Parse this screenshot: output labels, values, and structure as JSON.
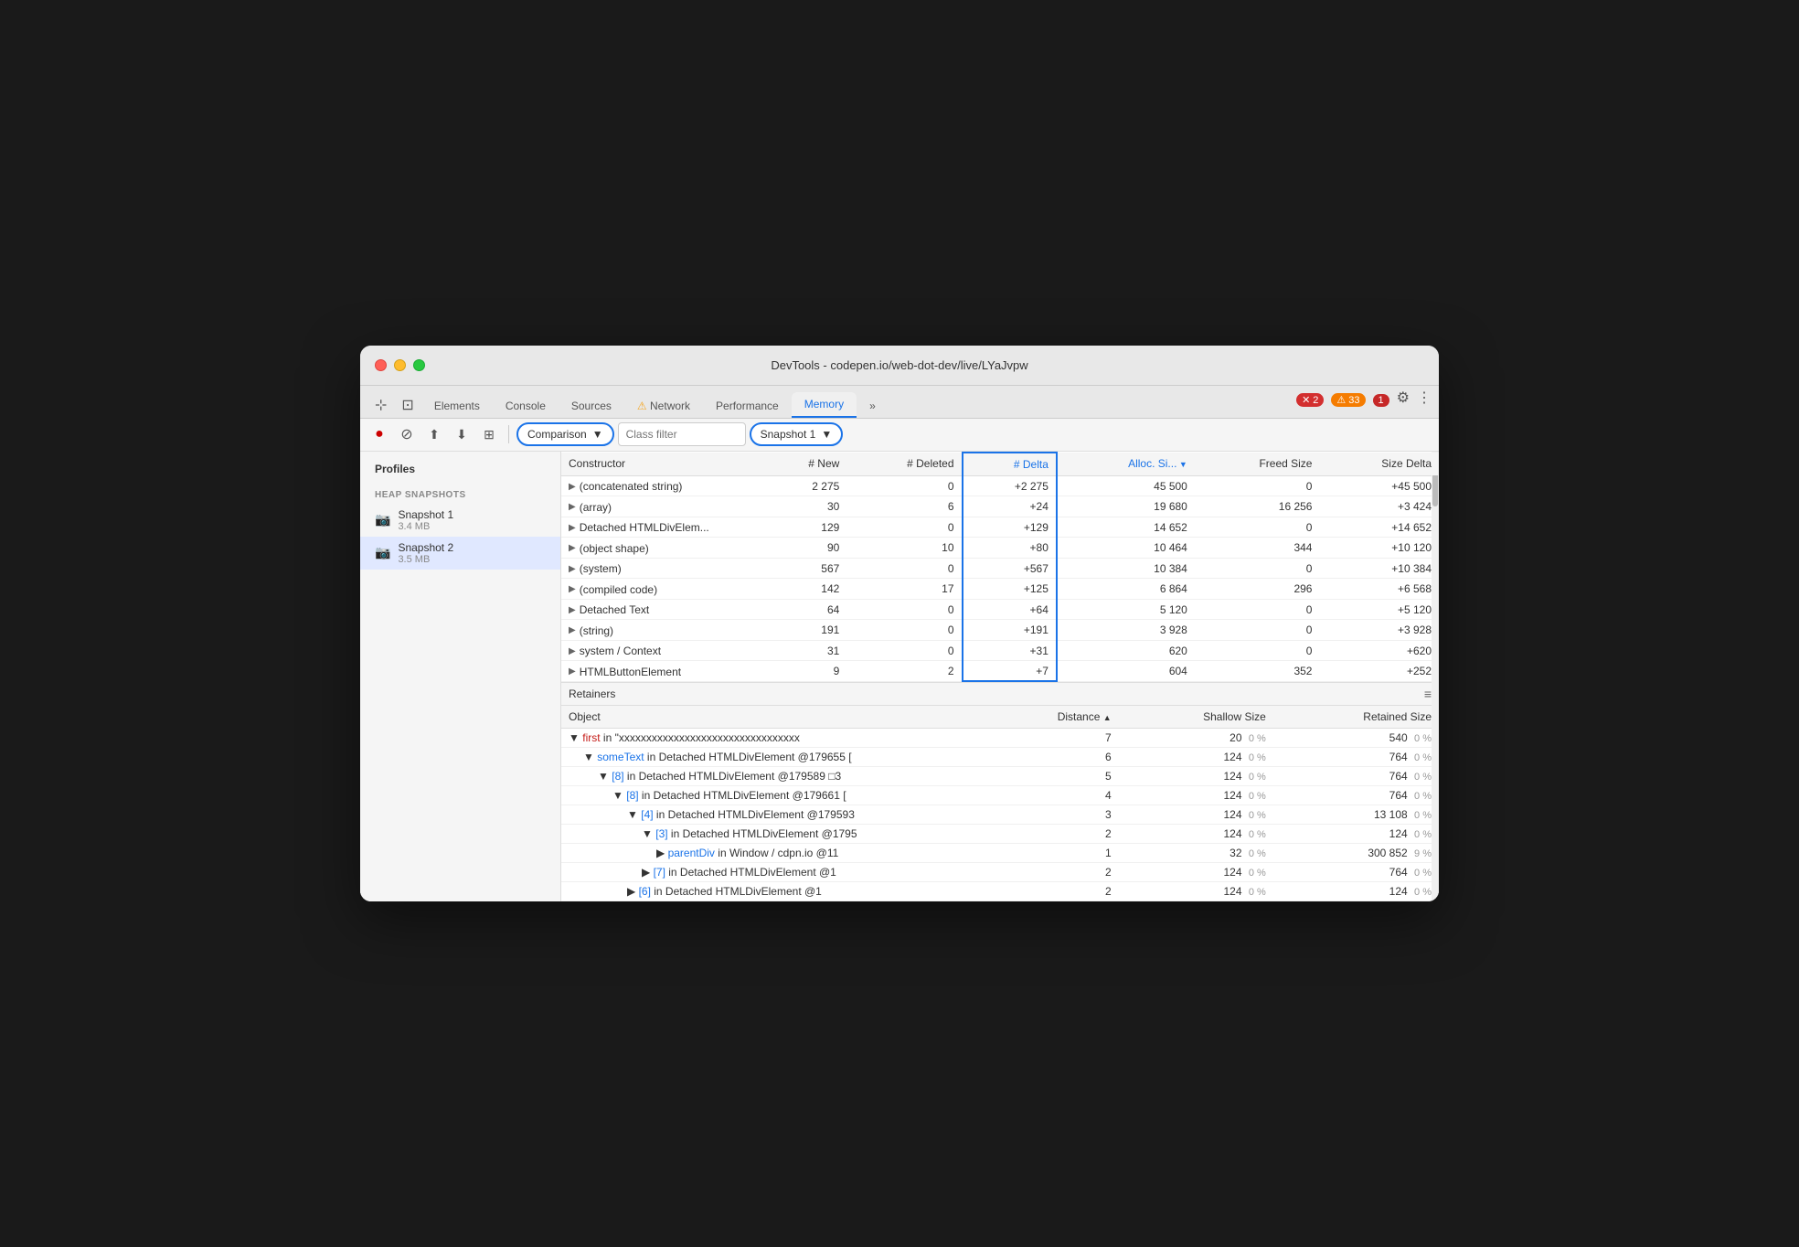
{
  "window": {
    "title": "DevTools - codepen.io/web-dot-dev/live/LYaJvpw"
  },
  "traffic_lights": {
    "close": "close",
    "minimize": "minimize",
    "maximize": "maximize"
  },
  "tabs": [
    {
      "id": "cursor",
      "label": "",
      "icon": "⊹"
    },
    {
      "id": "elements",
      "label": "Elements",
      "icon": ""
    },
    {
      "id": "console",
      "label": "Console",
      "icon": ""
    },
    {
      "id": "sources",
      "label": "Sources",
      "icon": ""
    },
    {
      "id": "network",
      "label": "Network",
      "icon": "⚠️",
      "has_warning": true
    },
    {
      "id": "performance",
      "label": "Performance",
      "icon": ""
    },
    {
      "id": "memory",
      "label": "Memory",
      "icon": "",
      "active": true
    },
    {
      "id": "more",
      "label": "»",
      "icon": ""
    }
  ],
  "badges": {
    "errors": "2",
    "warnings": "33",
    "info": "1"
  },
  "toolbar": {
    "record_label": "●",
    "clear_label": "⊘",
    "upload_label": "⬆",
    "download_label": "⬇",
    "settings_label": "⚙",
    "comparison_label": "Comparison",
    "class_filter_placeholder": "Class filter",
    "snapshot_label": "Snapshot 1",
    "snapshot_dropdown_arrow": "▼",
    "comparison_dropdown_arrow": "▼"
  },
  "sidebar": {
    "profiles_title": "Profiles",
    "heap_snapshots_title": "HEAP SNAPSHOTS",
    "snapshots": [
      {
        "id": 1,
        "name": "Snapshot 1",
        "size": "3.4 MB",
        "active": false
      },
      {
        "id": 2,
        "name": "Snapshot 2",
        "size": "3.5 MB",
        "active": true
      }
    ]
  },
  "comparison_table": {
    "headers": [
      {
        "id": "constructor",
        "label": "Constructor"
      },
      {
        "id": "new",
        "label": "# New"
      },
      {
        "id": "deleted",
        "label": "# Deleted"
      },
      {
        "id": "delta",
        "label": "# Delta",
        "highlighted": true
      },
      {
        "id": "alloc_size",
        "label": "Alloc. Si...",
        "sort": "desc"
      },
      {
        "id": "freed_size",
        "label": "Freed Size"
      },
      {
        "id": "size_delta",
        "label": "Size Delta"
      }
    ],
    "rows": [
      {
        "constructor": "(concatenated string)",
        "new": "2 275",
        "deleted": "0",
        "delta": "+2 275",
        "alloc_size": "45 500",
        "freed_size": "0",
        "size_delta": "+45 500"
      },
      {
        "constructor": "(array)",
        "new": "30",
        "deleted": "6",
        "delta": "+24",
        "alloc_size": "19 680",
        "freed_size": "16 256",
        "size_delta": "+3 424"
      },
      {
        "constructor": "Detached HTMLDivElem...",
        "new": "129",
        "deleted": "0",
        "delta": "+129",
        "alloc_size": "14 652",
        "freed_size": "0",
        "size_delta": "+14 652"
      },
      {
        "constructor": "(object shape)",
        "new": "90",
        "deleted": "10",
        "delta": "+80",
        "alloc_size": "10 464",
        "freed_size": "344",
        "size_delta": "+10 120"
      },
      {
        "constructor": "(system)",
        "new": "567",
        "deleted": "0",
        "delta": "+567",
        "alloc_size": "10 384",
        "freed_size": "0",
        "size_delta": "+10 384"
      },
      {
        "constructor": "(compiled code)",
        "new": "142",
        "deleted": "17",
        "delta": "+125",
        "alloc_size": "6 864",
        "freed_size": "296",
        "size_delta": "+6 568"
      },
      {
        "constructor": "Detached Text",
        "new": "64",
        "deleted": "0",
        "delta": "+64",
        "alloc_size": "5 120",
        "freed_size": "0",
        "size_delta": "+5 120"
      },
      {
        "constructor": "(string)",
        "new": "191",
        "deleted": "0",
        "delta": "+191",
        "alloc_size": "3 928",
        "freed_size": "0",
        "size_delta": "+3 928"
      },
      {
        "constructor": "system / Context",
        "new": "31",
        "deleted": "0",
        "delta": "+31",
        "alloc_size": "620",
        "freed_size": "0",
        "size_delta": "+620"
      },
      {
        "constructor": "HTMLButtonElement",
        "new": "9",
        "deleted": "2",
        "delta": "+7",
        "alloc_size": "604",
        "freed_size": "352",
        "size_delta": "+252"
      }
    ]
  },
  "retainers": {
    "title": "Retainers",
    "headers": [
      {
        "id": "object",
        "label": "Object"
      },
      {
        "id": "distance",
        "label": "Distance",
        "sort": "asc"
      },
      {
        "id": "shallow_size",
        "label": "Shallow Size"
      },
      {
        "id": "retained_size",
        "label": "Retained Size"
      }
    ],
    "rows": [
      {
        "indent": 0,
        "toggle": "▼",
        "prefix_red": "first",
        "text": " in \"xxxxxxxxxxxxxxxxxxxxxxxxxxxxxxxxx",
        "distance": "7",
        "shallow": "20",
        "shallow_pct": "0 %",
        "retained": "540",
        "retained_pct": "0 %"
      },
      {
        "indent": 1,
        "toggle": "▼",
        "prefix_blue": "someText",
        "text": " in Detached HTMLDivElement @179655 [",
        "distance": "6",
        "shallow": "124",
        "shallow_pct": "0 %",
        "retained": "764",
        "retained_pct": "0 %"
      },
      {
        "indent": 2,
        "toggle": "▼",
        "prefix_blue": "[8]",
        "text": " in Detached HTMLDivElement @179589 □3",
        "distance": "5",
        "shallow": "124",
        "shallow_pct": "0 %",
        "retained": "764",
        "retained_pct": "0 %"
      },
      {
        "indent": 3,
        "toggle": "▼",
        "prefix_blue": "[8]",
        "text": " in Detached HTMLDivElement @179661 [",
        "distance": "4",
        "shallow": "124",
        "shallow_pct": "0 %",
        "retained": "764",
        "retained_pct": "0 %"
      },
      {
        "indent": 4,
        "toggle": "▼",
        "prefix_blue": "[4]",
        "text": " in Detached HTMLDivElement @179593",
        "distance": "3",
        "shallow": "124",
        "shallow_pct": "0 %",
        "retained": "13 108",
        "retained_pct": "0 %"
      },
      {
        "indent": 5,
        "toggle": "▼",
        "prefix_blue": "[3]",
        "text": " in Detached HTMLDivElement @1795",
        "distance": "2",
        "shallow": "124",
        "shallow_pct": "0 %",
        "retained": "124",
        "retained_pct": "0 %"
      },
      {
        "indent": 6,
        "toggle": "▶",
        "prefix_blue": "parentDiv",
        "text": " in Window / cdpn.io @11",
        "distance": "1",
        "shallow": "32",
        "shallow_pct": "0 %",
        "retained": "300 852",
        "retained_pct": "9 %"
      },
      {
        "indent": 5,
        "toggle": "▶",
        "prefix_blue": "[7]",
        "text": " in Detached HTMLDivElement @1",
        "distance": "2",
        "shallow": "124",
        "shallow_pct": "0 %",
        "retained": "764",
        "retained_pct": "0 %"
      },
      {
        "indent": 4,
        "toggle": "▶",
        "prefix_blue": "[6]",
        "text": " in Detached HTMLDivElement @1",
        "distance": "2",
        "shallow": "124",
        "shallow_pct": "0 %",
        "retained": "124",
        "retained_pct": "0 %"
      }
    ]
  },
  "colors": {
    "accent_blue": "#1a73e8",
    "text_red": "#c41a16",
    "text_blue": "#1a73e8",
    "bg_light": "#f5f5f5",
    "border": "#ddd"
  }
}
